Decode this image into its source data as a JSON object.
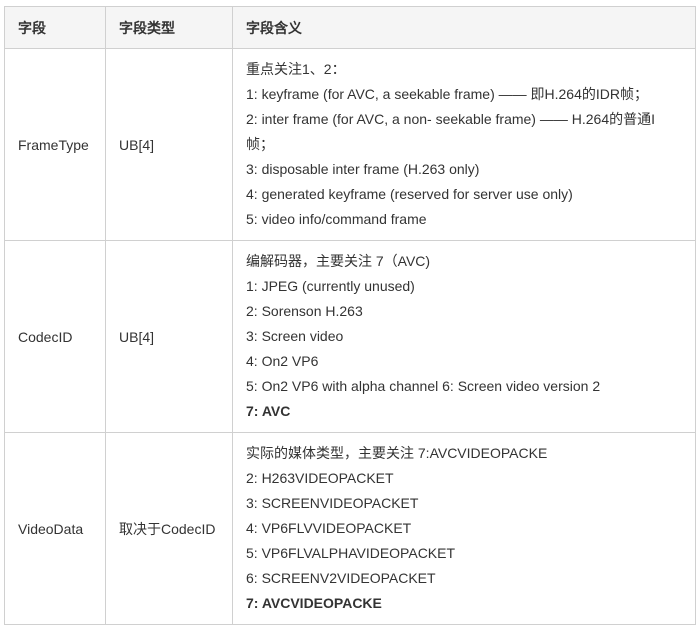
{
  "headers": [
    "字段",
    "字段类型",
    "字段含义"
  ],
  "rows": [
    {
      "field": "FrameType",
      "type": "UB[4]",
      "lines": [
        "重点关注1、2：",
        "1: keyframe (for AVC, a seekable frame) —— 即H.264的IDR帧；",
        "2: inter frame (for AVC, a non- seekable frame) —— H.264的普通I帧；",
        "3: disposable inter frame (H.263 only)",
        "4: generated keyframe (reserved for server use only)",
        "5: video info/command frame"
      ],
      "bold_last": false
    },
    {
      "field": "CodecID",
      "type": "UB[4]",
      "lines": [
        "编解码器，主要关注 7（AVC)",
        "1: JPEG (currently unused)",
        "2: Sorenson H.263",
        "3: Screen video",
        "4: On2 VP6",
        "5: On2 VP6 with alpha channel 6: Screen video version 2",
        "7: AVC"
      ],
      "bold_last": true
    },
    {
      "field": "VideoData",
      "type": "取决于CodecID",
      "lines": [
        "实际的媒体类型，主要关注 7:AVCVIDEOPACKE",
        "2: H263VIDEOPACKET",
        "3: SCREENVIDEOPACKET",
        "4: VP6FLVVIDEOPACKET",
        "5: VP6FLVALPHAVIDEOPACKET",
        "6: SCREENV2VIDEOPACKET",
        "7: AVCVIDEOPACKE"
      ],
      "bold_last": true
    }
  ]
}
